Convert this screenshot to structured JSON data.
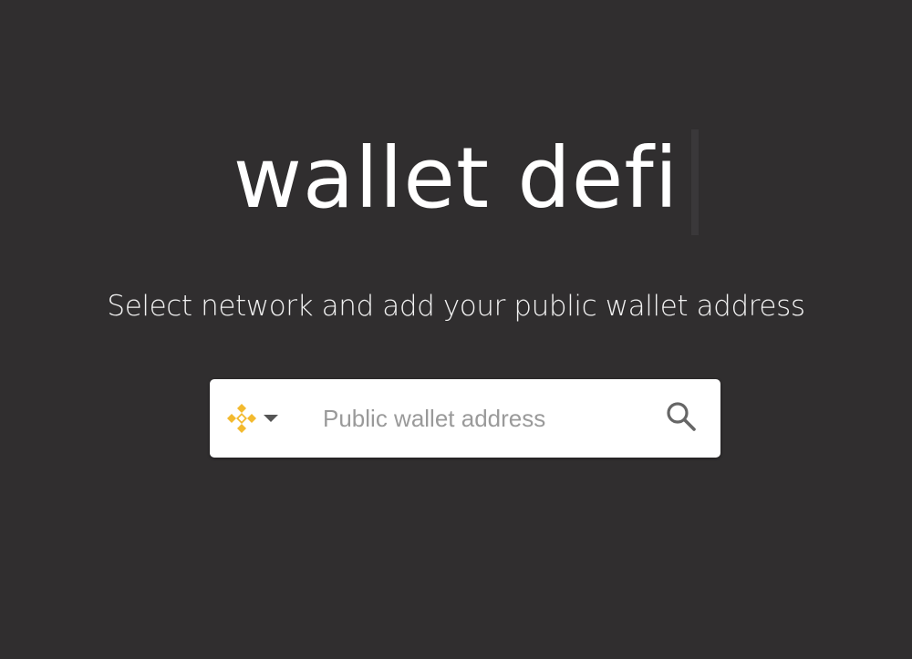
{
  "brand": {
    "title": "wallet defi"
  },
  "subtitle": "Select network and add your public wallet address",
  "search": {
    "network": "BNB Chain",
    "network_icon": "binance-icon",
    "network_color": "#f3ba2f",
    "placeholder": "Public wallet address",
    "value": "",
    "search_icon": "search-icon"
  },
  "colors": {
    "background": "#302e2f",
    "text": "#ffffff",
    "input_bg": "#ffffff"
  }
}
